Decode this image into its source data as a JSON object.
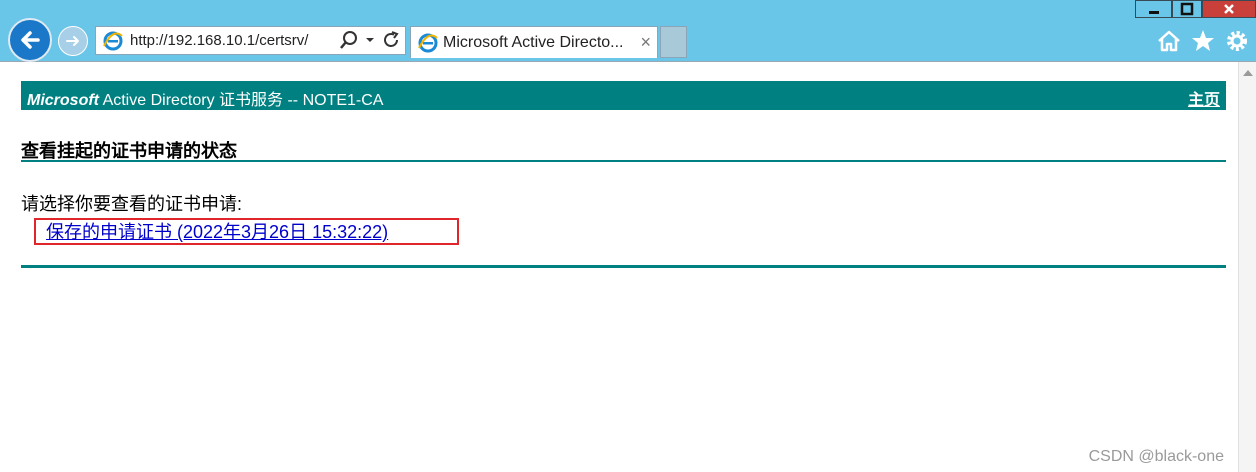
{
  "browser": {
    "address": "http://192.168.10.1/certsrv/",
    "tab_title": "Microsoft Active Directo...",
    "tab_close": "×"
  },
  "header": {
    "brand": "Microsoft",
    "title": " Active Directory 证书服务  --  NOTE1-CA",
    "home_link": "主页"
  },
  "page": {
    "title": "查看挂起的证书申请的状态",
    "prompt": "请选择你要查看的证书申请:",
    "requests": [
      {
        "label": "保存的申请证书 (2022年3月26日 15:32:22)"
      }
    ]
  },
  "watermark": "CSDN @black-one",
  "colors": {
    "accent": "#008080",
    "link": "#0000cc",
    "highlight": "#e0262b",
    "chrome": "#6ac6e8"
  }
}
